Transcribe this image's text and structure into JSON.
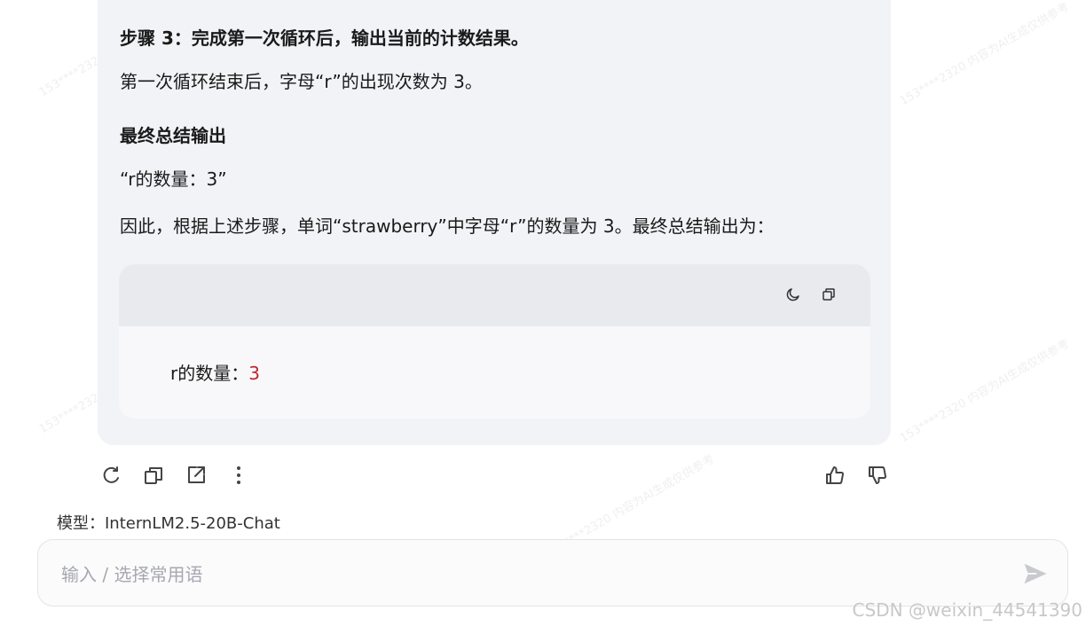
{
  "watermark_text": "153****2320 内容为AI生成仅供参考",
  "message": {
    "step3_heading": "步骤 3：完成第一次循环后，输出当前的计数结果。",
    "step3_text": "第一次循环结束后，字母“r”的出现次数为 3。",
    "final_heading": "最终总结输出",
    "quote_output": "“r的数量：3”",
    "conclusion": "因此，根据上述步骤，单词“strawberry”中字母“r”的数量为 3。最终总结输出为："
  },
  "code_block": {
    "label": "r的数量：",
    "value": "3",
    "icons": [
      "moon-icon",
      "copy-icon"
    ]
  },
  "actions": {
    "left_icons": [
      "regenerate-icon",
      "copy-icon",
      "share-icon",
      "more-icon"
    ],
    "right_icons": [
      "thumbs-up-icon",
      "thumbs-down-icon"
    ]
  },
  "model_label": "模型：InternLM2.5-20B-Chat",
  "input": {
    "placeholder": "输入 / 选择常用语",
    "value": ""
  },
  "footer_watermark": "CSDN @weixin_44541390",
  "colors": {
    "bubble_bg": "#f2f3f7",
    "code_header_bg": "#e9eaee",
    "number_red": "#c0282d",
    "send_icon": "#c9cace"
  }
}
